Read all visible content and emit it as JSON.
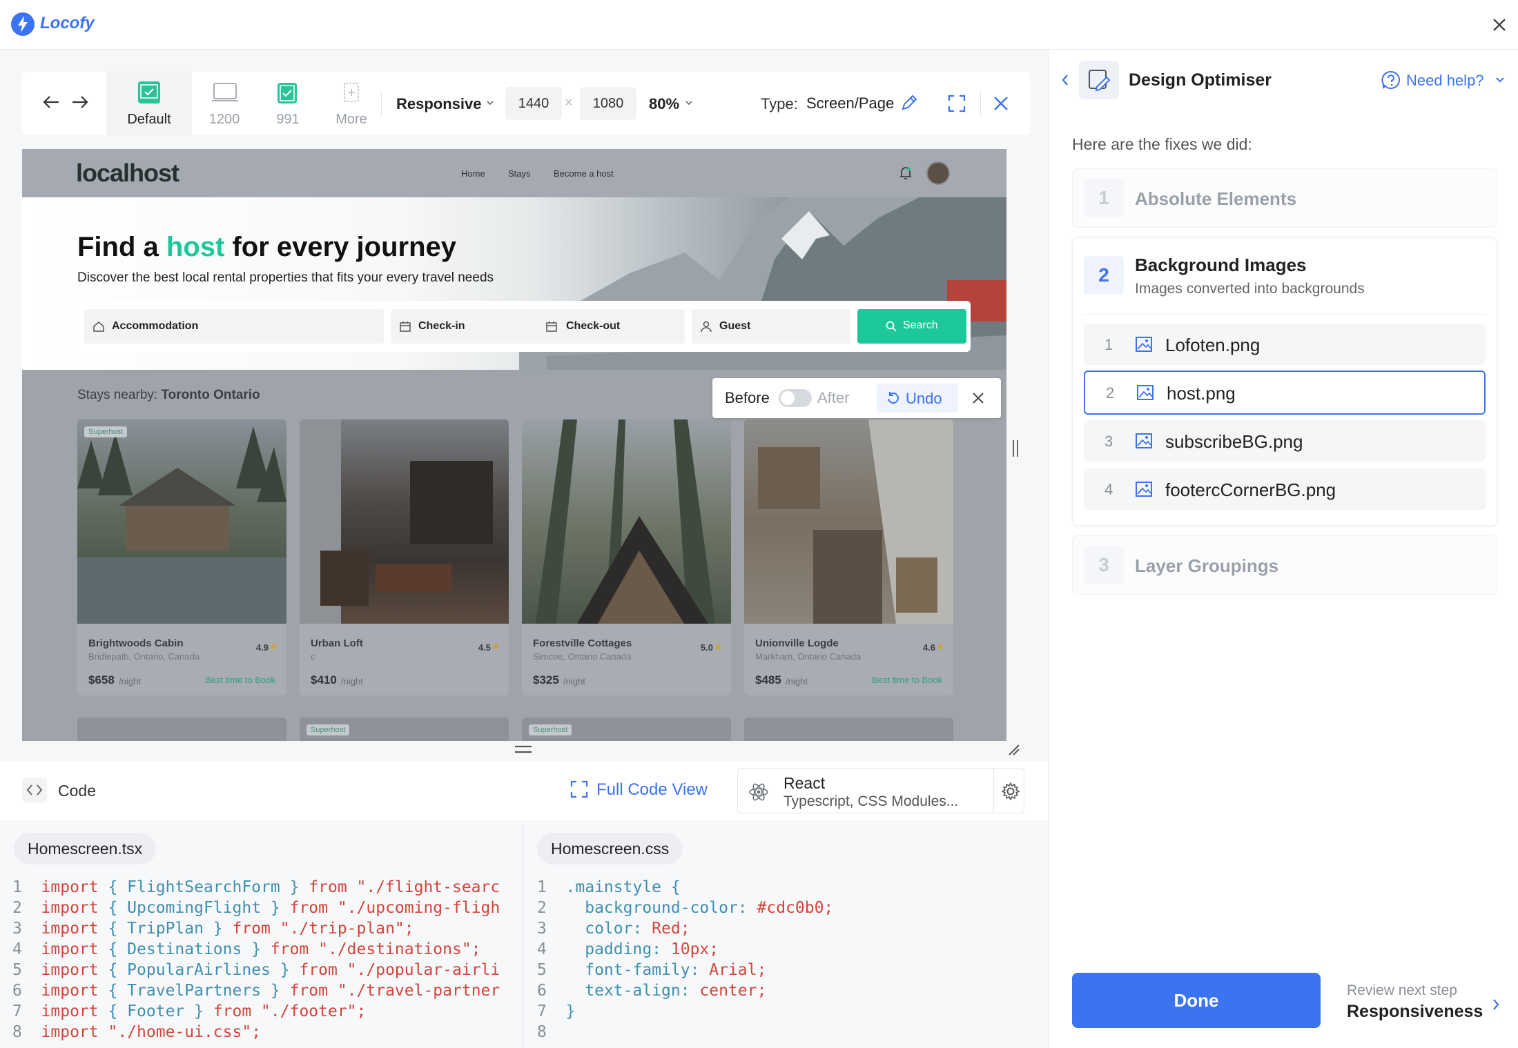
{
  "app": {
    "name": "Locofy"
  },
  "toolbar": {
    "breakpoints": [
      {
        "label": "Default",
        "checked": true,
        "active": true
      },
      {
        "label": "1200",
        "checked": false,
        "active": false
      },
      {
        "label": "991",
        "checked": true,
        "active": false
      },
      {
        "label": "More",
        "checked": false,
        "active": false
      }
    ],
    "mode": "Responsive",
    "width": "1440",
    "times": "×",
    "height": "1080",
    "zoom": "80%",
    "type_label": "Type:",
    "type_value": "Screen/Page"
  },
  "site": {
    "logo": "localhost",
    "nav": [
      "Home",
      "Stays",
      "Become a host"
    ],
    "hero_title_pre": "Find a ",
    "hero_title_accent": "host",
    "hero_title_post": " for every journey",
    "hero_sub": "Discover the best local rental properties that fits your every travel needs",
    "search": {
      "accommodation": "Accommodation",
      "checkin": "Check-in",
      "checkout": "Check-out",
      "guest": "Guest",
      "button": "Search"
    },
    "stays_label": "Stays nearby: ",
    "stays_city": "Toronto Ontario",
    "superhost": "Superhost",
    "cards": [
      {
        "name": "Brightwoods Cabin",
        "location": "Bridlepath, Ontario, Canada",
        "rating": "4.9",
        "price": "$658",
        "per": "/night",
        "badge": "Best time to Book"
      },
      {
        "name": "Urban Loft",
        "location": "c",
        "rating": "4.5",
        "price": "$410",
        "per": "/night",
        "badge": ""
      },
      {
        "name": "Forestville Cottages",
        "location": "Simcoe, Ontario Canada",
        "rating": "5.0",
        "price": "$325",
        "per": "/night",
        "badge": ""
      },
      {
        "name": "Unionville Logde",
        "location": "Markham, Ontario Canada",
        "rating": "4.6",
        "price": "$485",
        "per": "/night",
        "badge": "Best time to Book"
      }
    ]
  },
  "before_after": {
    "before": "Before",
    "after": "After",
    "undo": "Undo"
  },
  "code": {
    "title": "Code",
    "full_view": "Full Code View",
    "framework": "React",
    "framework_sub": "Typescript, CSS Modules...",
    "file1": "Homescreen.tsx",
    "file2": "Homescreen.css",
    "tsx_lines": [
      {
        "n": "1",
        "a": "import",
        "b": " { FlightSearchForm } ",
        "c": "from",
        "d": " \"./flight-searc"
      },
      {
        "n": "2",
        "a": "import",
        "b": " { UpcomingFlight } ",
        "c": "from",
        "d": " \"./upcoming-fligh"
      },
      {
        "n": "3",
        "a": "import",
        "b": " { TripPlan } ",
        "c": "from",
        "d": " \"./trip-plan\";"
      },
      {
        "n": "4",
        "a": "import",
        "b": " { Destinations } ",
        "c": "from",
        "d": " \"./destinations\";"
      },
      {
        "n": "5",
        "a": "import",
        "b": " { PopularAirlines } ",
        "c": "from",
        "d": " \"./popular-airli"
      },
      {
        "n": "6",
        "a": "import",
        "b": " { TravelPartners } ",
        "c": "from",
        "d": " \"./travel-partner"
      },
      {
        "n": "7",
        "a": "import",
        "b": " { Footer } ",
        "c": "from",
        "d": " \"./footer\";"
      },
      {
        "n": "8",
        "a": "import",
        "b": "",
        "c": "",
        "d": " \"./home-ui.css\";"
      }
    ],
    "css_lines": [
      {
        "n": "1",
        "a": ".mainstyle {",
        "b": ""
      },
      {
        "n": "2",
        "a": "  background-color:",
        "b": " #cdc0b0;"
      },
      {
        "n": "3",
        "a": "  color:",
        "b": " Red;"
      },
      {
        "n": "4",
        "a": "  padding:",
        "b": " 10px;"
      },
      {
        "n": "5",
        "a": "  font-family:",
        "b": " Arial;"
      },
      {
        "n": "6",
        "a": "  text-align:",
        "b": " center;"
      },
      {
        "n": "7",
        "a": "}",
        "b": ""
      },
      {
        "n": "8",
        "a": "",
        "b": ""
      }
    ]
  },
  "panel": {
    "title": "Design Optimiser",
    "help": "Need help?",
    "intro": "Here are the fixes we did:",
    "fixes": [
      {
        "num": "1",
        "title": "Absolute Elements"
      },
      {
        "num": "2",
        "title": "Background Images",
        "desc": "Images converted into backgrounds"
      },
      {
        "num": "3",
        "title": "Layer Groupings"
      }
    ],
    "images": [
      {
        "i": "1",
        "name": "Lofoten.png",
        "selected": false
      },
      {
        "i": "2",
        "name": "host.png",
        "selected": true
      },
      {
        "i": "3",
        "name": "subscribeBG.png",
        "selected": false
      },
      {
        "i": "4",
        "name": "footercCornerBG.png",
        "selected": false
      }
    ],
    "done": "Done",
    "next_label": "Review next step",
    "next_step": "Responsiveness"
  },
  "colors": {
    "accent": "#3b73f0",
    "green": "#1cc89a",
    "check": "#2cc39a"
  }
}
